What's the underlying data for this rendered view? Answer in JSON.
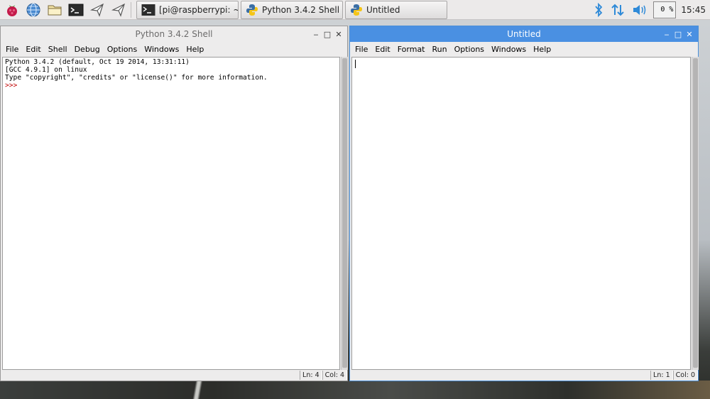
{
  "taskbar": {
    "launchers": [
      {
        "name": "menu",
        "icon": "raspberry-icon"
      },
      {
        "name": "web-browser",
        "icon": "globe-icon"
      },
      {
        "name": "file-manager",
        "icon": "folder-icon"
      },
      {
        "name": "terminal",
        "icon": "terminal-icon"
      },
      {
        "name": "wolfram-1",
        "icon": "send-icon"
      },
      {
        "name": "wolfram-2",
        "icon": "send-icon"
      }
    ],
    "tasks": [
      {
        "label": "[pi@raspberrypi: ~]",
        "icon": "terminal-icon"
      },
      {
        "label": "Python 3.4.2 Shell",
        "icon": "python-icon"
      },
      {
        "label": "Untitled",
        "icon": "python-icon"
      }
    ],
    "tray": {
      "bluetooth_icon": "bluetooth-icon",
      "network_icon": "network-arrows-icon",
      "volume_icon": "volume-icon",
      "cpu_usage": "0 %",
      "clock": "15:45"
    },
    "colors": {
      "tray_accent": "#2f8ad8"
    }
  },
  "shell_window": {
    "title": "Python 3.4.2 Shell",
    "menu": [
      "File",
      "Edit",
      "Shell",
      "Debug",
      "Options",
      "Windows",
      "Help"
    ],
    "lines": [
      "Python 3.4.2 (default, Oct 19 2014, 13:31:11)",
      "[GCC 4.9.1] on linux",
      "Type \"copyright\", \"credits\" or \"license()\" for more information."
    ],
    "prompt": ">>>",
    "status": {
      "ln": "Ln: 4",
      "col": "Col: 4"
    }
  },
  "editor_window": {
    "title": "Untitled",
    "menu": [
      "File",
      "Edit",
      "Format",
      "Run",
      "Options",
      "Windows",
      "Help"
    ],
    "status": {
      "ln": "Ln: 1",
      "col": "Col: 0"
    },
    "colors": {
      "titlebar": "#4a90e2"
    }
  },
  "window_buttons": {
    "minimize": "‒",
    "maximize": "□",
    "close": "✕"
  }
}
